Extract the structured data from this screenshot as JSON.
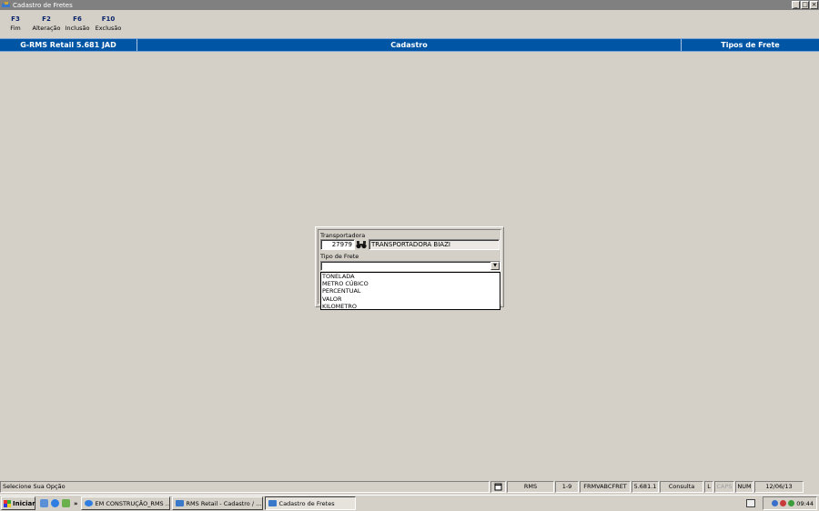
{
  "window": {
    "title": "Cadastro de Fretes",
    "controls": [
      "_",
      "□",
      "×"
    ]
  },
  "toolbar": [
    {
      "key": "F3",
      "label": "Fim"
    },
    {
      "key": "F2",
      "label": "Alteração"
    },
    {
      "key": "F6",
      "label": "Inclusão"
    },
    {
      "key": "F10",
      "label": "Exclusão"
    }
  ],
  "header": {
    "system": "G-RMS Retail 5.681 JAD",
    "module": "Cadastro",
    "section": "Tipos de Frete"
  },
  "form": {
    "transportadora_label": "Transportadora",
    "transportadora_code": "27979",
    "transportadora_name": "TRANSPORTADORA BIAZI",
    "tipo_frete_label": "Tipo de Frete",
    "tipo_frete_value": "",
    "options": [
      "TONELADA",
      "METRO CÚBICO",
      "PERCENTUAL",
      "VALOR",
      "KILOMETRO"
    ]
  },
  "statusbar": {
    "message": "Selecione Sua Opção",
    "db": "RMS",
    "version_range": "1-9",
    "form": "FRMVABCFRET",
    "version": "5.681.1",
    "mode": "Consulta",
    "l": "L",
    "caps": "CAPS",
    "num": "NUM",
    "date": "12/06/13"
  },
  "taskbar": {
    "start": "Iniciar",
    "tasks": [
      "EM CONSTRUÇÃO_RMS ...",
      "RMS Retail - Cadastro / ...",
      "Cadastro de Fretes"
    ],
    "time": "09:44"
  },
  "colors": {
    "header_blue": "#0055a5",
    "key_blue": "#0a246a",
    "title_gray": "#808080"
  }
}
